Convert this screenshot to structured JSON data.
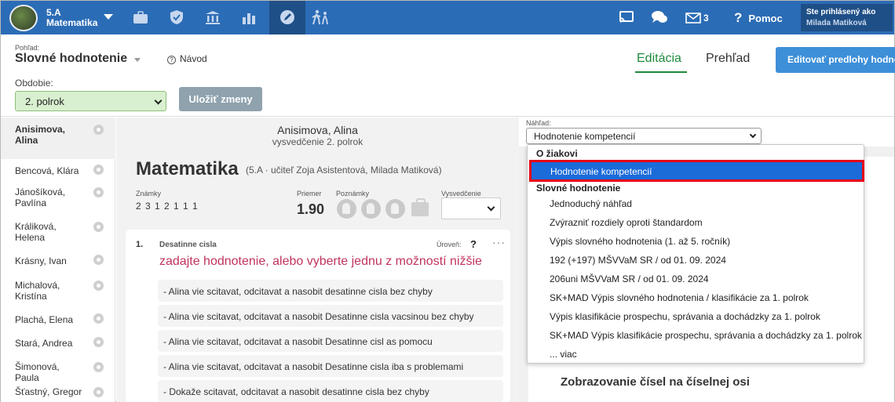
{
  "topbar": {
    "class_name": "5.A",
    "class_subject": "Matematika",
    "messages_count": "3",
    "help_label": "Pomoc",
    "logged_in_label": "Ste prihlásený ako",
    "user_name": "Milada Matiková",
    "icons": [
      "briefcase-icon",
      "shield-check-icon",
      "institution-icon",
      "bar-chart-icon",
      "pencil-circle-icon",
      "walking-people-icon",
      "cast-icon",
      "chat-icon",
      "mail-icon",
      "help-icon"
    ]
  },
  "header": {
    "view_label": "Pohľad:",
    "view_title": "Slovné hodnotenie",
    "guide_label": "Návod",
    "period_label": "Obdobie:",
    "period_value": "2. polrok",
    "save_label": "Uložiť zmeny",
    "tab_edit": "Editácia",
    "tab_overview": "Prehľad",
    "edit_templates": "Editovať predlohy hodnotenia"
  },
  "students": [
    {
      "name": "Anisimova, Alina",
      "active": true
    },
    {
      "name": "Bencová, Klára"
    },
    {
      "name": "Jánošíková, Pavlína"
    },
    {
      "name": "Králiková, Helena"
    },
    {
      "name": "Krásny, Ivan"
    },
    {
      "name": "Michalová, Kristína"
    },
    {
      "name": "Plachá, Elena"
    },
    {
      "name": "Stará, Andrea"
    },
    {
      "name": "Šimonová, Paula"
    },
    {
      "name": "Šťastný, Gregor"
    }
  ],
  "middle": {
    "student_name": "Anisimova, Alina",
    "certificate_sub": "vysvedčenie 2. polrok",
    "subject": "Matematika",
    "subject_sub": "(5.A · učiteľ Zoja Asistentová, Milada Matiková)",
    "grades_label": "Známky",
    "grades": "2 3 1 2 1 1 1",
    "average_label": "Priemer",
    "average": "1.90",
    "notes_label": "Poznámky",
    "certificate_label": "Vysvedčenie",
    "card": {
      "number": "1.",
      "title": "Desatinne cisla",
      "level_label": "Úroveň:",
      "level_value": "?",
      "more": "···",
      "prompt": "zadajte hodnotenie, alebo vyberte jednu z možností nižšie",
      "options": [
        "-  Alina vie scitavat, odcitavat a nasobit desatinne cisla bez chyby",
        "-  Alina vie scitavat, odcitavat a nasobit Desatinne cisla vacsinou bez chyby",
        "-  Alina vie scitavat, odcitavat a nasobit Desatinne cisl as pomocu",
        "-  Alina vie scitavat, odcitavat a nasobit Desatinne cisla iba s problemami",
        "-  Dokaže scitavat, odcitavat a nasobit desatinne cisla bez chyby"
      ]
    }
  },
  "preview": {
    "label": "Náhľad:",
    "selected": "Hodnotenie kompetencií",
    "heading": "Zobrazovanie čísel na číselnej osi",
    "groups": [
      {
        "label": "O žiakovi"
      },
      {
        "label": "Slovné hodnotenie"
      }
    ],
    "highlighted_item": "Hodnotenie kompetencií",
    "items": [
      "Jednoduchý náhľad",
      "Zvýrazniť rozdiely oproti štandardom",
      "Výpis slovného hodnotenia (1. až 5. ročník)",
      "192 (+197) MŠVVaM SR / od 01. 09. 2024",
      "206uni MŠVVaM SR / od 01. 09. 2024",
      "SK+MAD Výpis slovného hodnotenia / klasifikácie za 1. polrok",
      "Výpis klasifikácie prospechu, správania a dochádzky za 1. polrok",
      "SK+MAD Výpis klasifikácie prospechu, správania a dochádzky za 1. polrok",
      "... viac"
    ]
  },
  "colors": {
    "topbar": "#2b6cb6",
    "accent_green": "#1e8a3c",
    "prompt_red": "#c0335c",
    "selected_blue": "#1b6bd9",
    "highlight_border": "#e60012"
  }
}
